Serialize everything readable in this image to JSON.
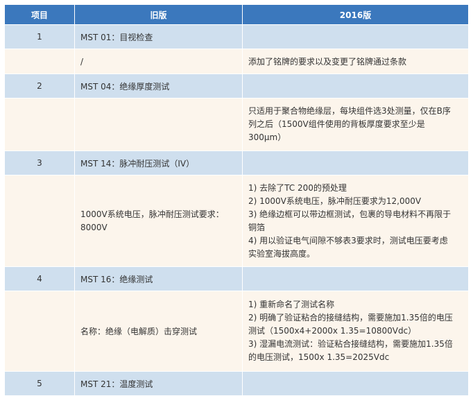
{
  "header": {
    "col1": "项目",
    "col2": "旧版",
    "col3": "2016版"
  },
  "rows": [
    {
      "item": "1",
      "old": "MST 01：目视检查"
    },
    {
      "old": "/",
      "new_lines": [
        "添加了铭牌的要求以及变更了铭牌通过条款"
      ]
    },
    {
      "item": "2",
      "old": "MST 04：绝缘厚度测试"
    },
    {
      "old": "",
      "new_lines": [
        "只适用于聚合物绝缘层，每块组件选3处测量，仅在B序",
        "列之后（1500V组件使用的背板厚度要求至少是",
        "300μm）"
      ]
    },
    {
      "item": "3",
      "old": "MST 14：脉冲耐压测试（IV）"
    },
    {
      "old_lines": [
        "1000V系统电压，脉冲耐压测试要求：",
        "8000V"
      ],
      "new_lines": [
        "1) 去除了TC 200的预处理",
        "2) 1000V系统电压，脉冲耐压要求为12,000V",
        "3) 绝缘边框可以带边框测试，包裹的导电材料不再限于",
        "铜箔",
        "4) 用以验证电气间隙不够表3要求时，测试电压要考虑",
        "实验室海拔高度。"
      ]
    },
    {
      "item": "4",
      "old": "MST 16：绝缘测试"
    },
    {
      "old": "名称：绝缘（电解质）击穿测试",
      "new_lines": [
        "1) 重新命名了测试名称",
        "2) 明确了验证粘合的接缝结构，需要施加1.35倍的电压",
        "测试（1500x4+2000x 1.35=10800Vdc）",
        "3) 湿漏电流测试：验证粘合接缝结构，需要施加1.35倍",
        "的电压测试，1500x 1.35=2025Vdc"
      ]
    },
    {
      "item": "5",
      "old": "MST 21：温度测试"
    }
  ]
}
